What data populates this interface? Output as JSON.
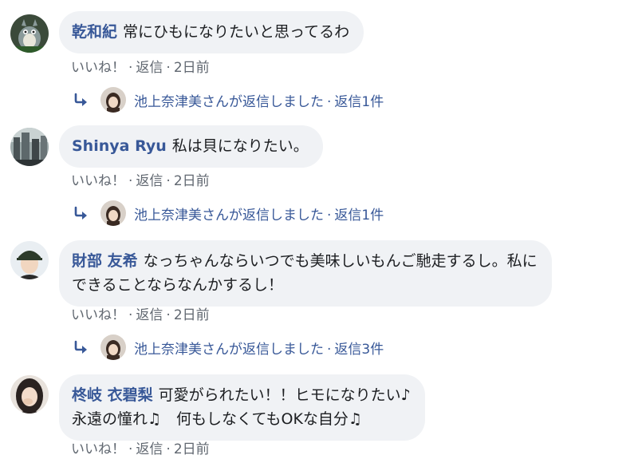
{
  "comments": [
    {
      "author": "乾和紀",
      "lines": [
        "常にひもになりたいと思ってるわ"
      ],
      "actions": {
        "like": "いいね！",
        "reply": "返信",
        "time": "2日前"
      },
      "reply_summary": {
        "text": "池上奈津美さんが返信しました",
        "count": "返信1件"
      }
    },
    {
      "author": "Shinya Ryu",
      "lines": [
        "私は貝になりたい。"
      ],
      "actions": {
        "like": "いいね！",
        "reply": "返信",
        "time": "2日前"
      },
      "reply_summary": {
        "text": "池上奈津美さんが返信しました",
        "count": "返信1件"
      }
    },
    {
      "author": "財部 友希",
      "lines": [
        "なっちゃんならいつでも美味しいもんご馳走するし。私に",
        "できることならなんかするし！"
      ],
      "actions": {
        "like": "いいね！",
        "reply": "返信",
        "time": "2日前"
      },
      "reply_summary": {
        "text": "池上奈津美さんが返信しました",
        "count": "返信3件"
      }
    },
    {
      "author": "柊岐 衣碧梨",
      "lines": [
        "可愛がられたい！！ヒモになりたい♪",
        "永遠の憧れ♫　何もしなくてもOKな自分♫"
      ],
      "actions": {
        "like": "いいね！",
        "reply": "返信",
        "time": "2日前"
      }
    }
  ],
  "colors": {
    "bubble_bg": "#f0f2f5",
    "author": "#385898",
    "meta": "#606770",
    "text": "#1c1e21"
  }
}
